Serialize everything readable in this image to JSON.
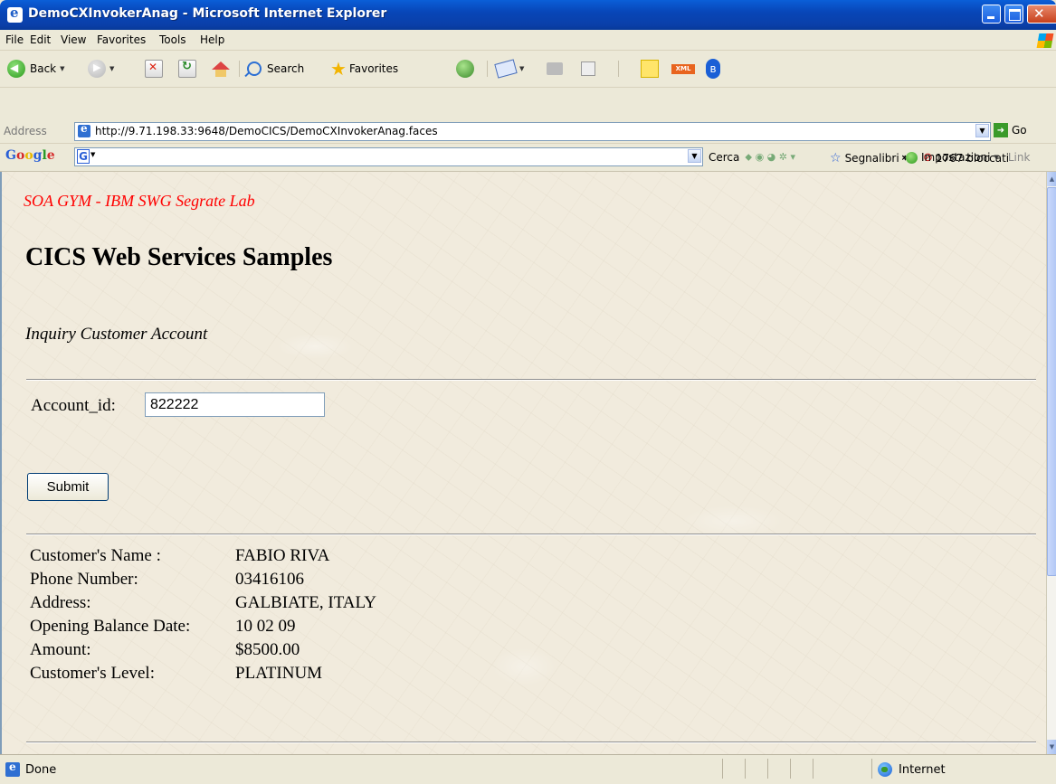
{
  "window": {
    "title": "DemoCXInvokerAnag - Microsoft Internet Explorer"
  },
  "menu": {
    "items": [
      "File",
      "Edit",
      "View",
      "Favorites",
      "Tools",
      "Help"
    ]
  },
  "toolbar": {
    "back_label": "Back",
    "search_label": "Search",
    "favorites_label": "Favorites",
    "xml_badge": "XML"
  },
  "address": {
    "label": "Address",
    "url": "http://9.71.198.33:9648/DemoCICS/DemoCXInvokerAnag.faces",
    "go_label": "Go"
  },
  "google_toolbar": {
    "logo": "Google",
    "search_label": "Cerca",
    "bookmarks_label": "Segnalibri",
    "popups_label": "1767 bloccati",
    "more_label": "»",
    "settings_label": "Impostazioni",
    "links_label": "Link"
  },
  "page": {
    "lab_title": "SOA GYM - IBM SWG Segrate Lab",
    "heading": "CICS Web Services Samples",
    "subheading": "Inquiry Customer Account",
    "account_label": "Account_id:",
    "account_value": "822222",
    "submit_label": "Submit",
    "customer": [
      {
        "label": "Customer's Name :",
        "value": "FABIO RIVA"
      },
      {
        "label": "Phone Number:",
        "value": "03416106"
      },
      {
        "label": "Address:",
        "value": "GALBIATE, ITALY"
      },
      {
        "label": "Opening Balance Date:",
        "value": "10 02 09"
      },
      {
        "label": "Amount:",
        "value": "$8500.00"
      },
      {
        "label": "Customer's Level:",
        "value": "PLATINUM"
      }
    ]
  },
  "status": {
    "text": "Done",
    "zone": "Internet"
  }
}
